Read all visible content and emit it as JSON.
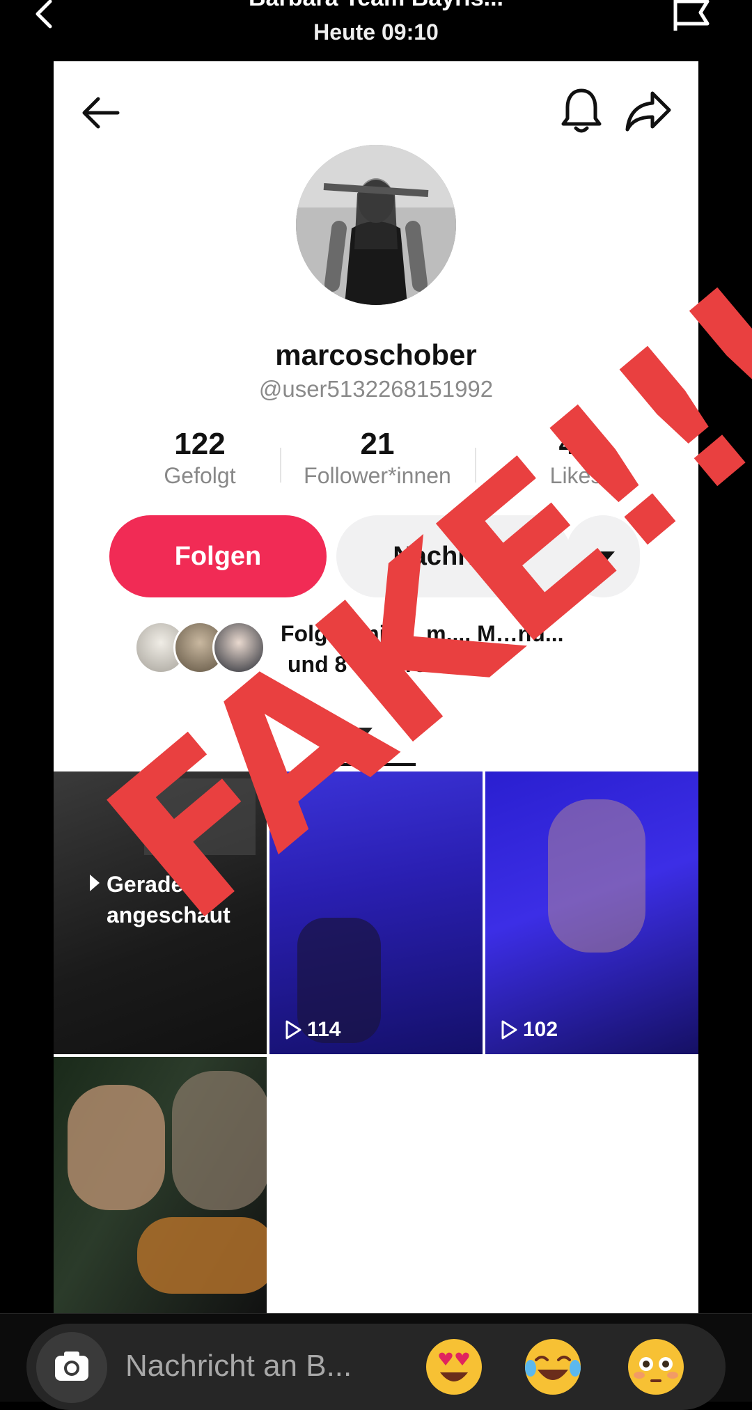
{
  "story": {
    "title": "Barbara Team Bayris...",
    "time": "Heute 09:10"
  },
  "profile": {
    "username": "marcoschober",
    "handle": "@user5132268151992",
    "stats": [
      {
        "value": "122",
        "label": "Gefolgt"
      },
      {
        "value": "21",
        "label": "Follower*innen"
      },
      {
        "value": "41",
        "label": "Likes"
      }
    ],
    "follow_label": "Folgen",
    "message_label": "Nachricht",
    "followed_by_line1": "Folgt Tanja …m..., M…nu...",
    "followed_by_line2": "und 8 anderen"
  },
  "videos": [
    {
      "pinned_label": "Gerade angeschaut",
      "views": ""
    },
    {
      "views": "114"
    },
    {
      "views": "102"
    },
    {
      "views": ""
    }
  ],
  "watermark": {
    "text": "FAKE!!!",
    "color": "#e94040"
  },
  "message_bar": {
    "placeholder": "Nachricht an B...",
    "emojis": [
      "heart-eyes-emoji",
      "tears-of-joy-emoji",
      "flushed-emoji"
    ]
  },
  "colors": {
    "follow_button": "#f12b55",
    "message_button": "#f1f1f2"
  }
}
